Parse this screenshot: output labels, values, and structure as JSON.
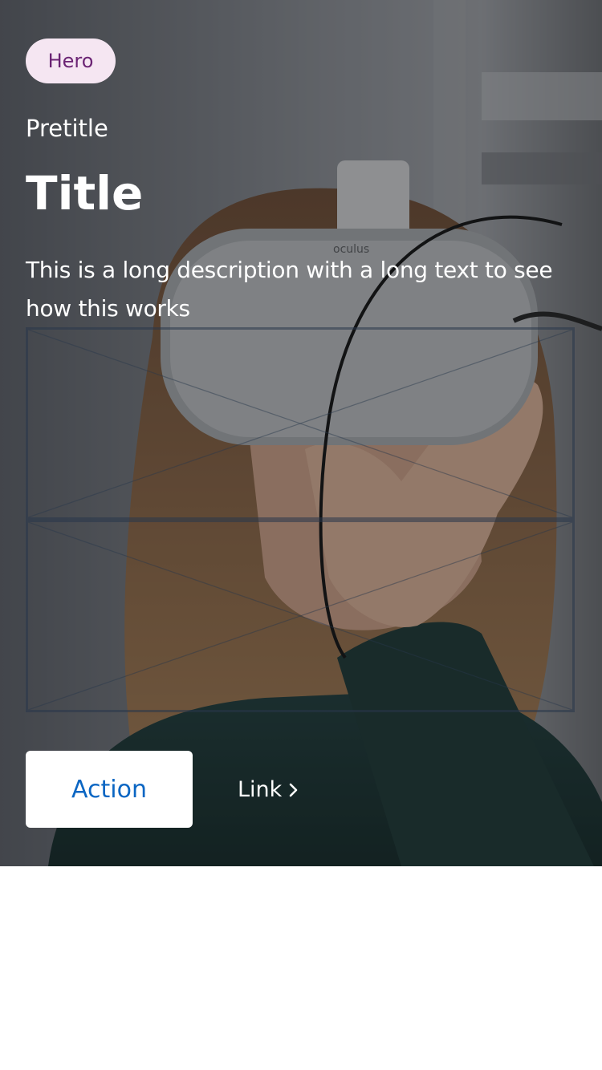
{
  "hero": {
    "tag": "Hero",
    "pretitle": "Pretitle",
    "title": "Title",
    "description": "This is a long description with a long text to see how this works",
    "photo_icon": "hero-photo-person-vr-headset"
  },
  "actions": {
    "primary_label": "Action",
    "link_label": "Link",
    "link_icon": "chevron-right-icon"
  },
  "colors": {
    "tag_background": "#f5e6f2",
    "tag_text": "#6b2474",
    "action_text": "#0b66c3",
    "text_on_image": "#ffffff",
    "page_background": "#ffffff"
  }
}
